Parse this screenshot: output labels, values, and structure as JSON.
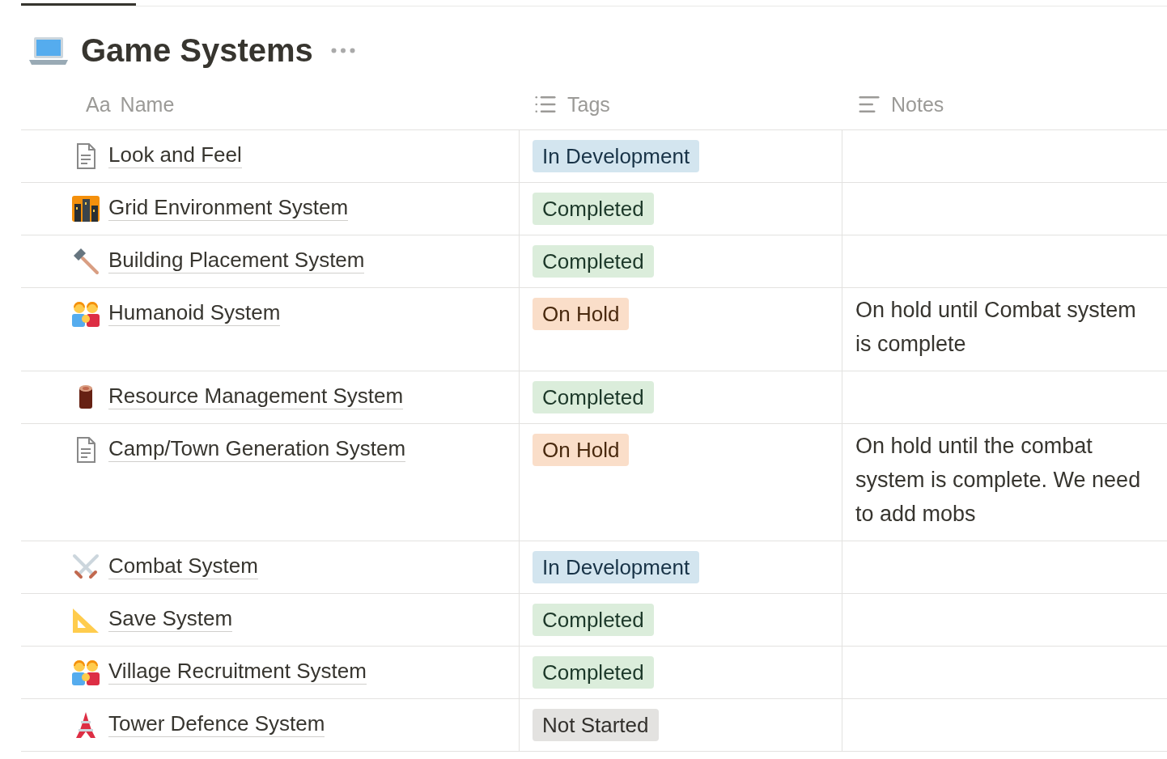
{
  "page": {
    "title": "Game Systems"
  },
  "columns": [
    {
      "kind": "name",
      "prefix": "Aa",
      "label": "Name"
    },
    {
      "kind": "tags",
      "label": "Tags"
    },
    {
      "kind": "notes",
      "label": "Notes"
    }
  ],
  "rows": [
    {
      "kind": "page",
      "name": "Look and Feel",
      "tag": {
        "label": "In Development",
        "color": "#d3e5ef"
      }
    },
    {
      "kind": "city",
      "name": "Grid Environment System",
      "tag": {
        "label": "Completed",
        "color": "#dbeddb"
      }
    },
    {
      "kind": "hammer",
      "name": "Building Placement System",
      "tag": {
        "label": "Completed",
        "color": "#dbeddb"
      }
    },
    {
      "kind": "people",
      "name": "Humanoid System",
      "tag": {
        "label": "On Hold",
        "color": "#fadec9"
      },
      "notes": "On hold until Combat system is complete"
    },
    {
      "kind": "log",
      "name": "Resource Management System",
      "tag": {
        "label": "Completed",
        "color": "#dbeddb"
      }
    },
    {
      "kind": "page",
      "name": "Camp/Town Generation System",
      "tag": {
        "label": "On Hold",
        "color": "#fadec9"
      },
      "notes": "On hold until the combat system is complete.  We need to add mobs"
    },
    {
      "kind": "swords",
      "name": "Combat System",
      "tag": {
        "label": "In Development",
        "color": "#d3e5ef"
      }
    },
    {
      "kind": "ruler",
      "name": "Save System",
      "tag": {
        "label": "Completed",
        "color": "#dbeddb"
      }
    },
    {
      "kind": "people",
      "name": "Village Recruitment System",
      "tag": {
        "label": "Completed",
        "color": "#dbeddb"
      }
    },
    {
      "kind": "tower",
      "name": "Tower Defence System",
      "tag": {
        "label": "Not Started",
        "color": "#e3e2e0"
      }
    }
  ]
}
